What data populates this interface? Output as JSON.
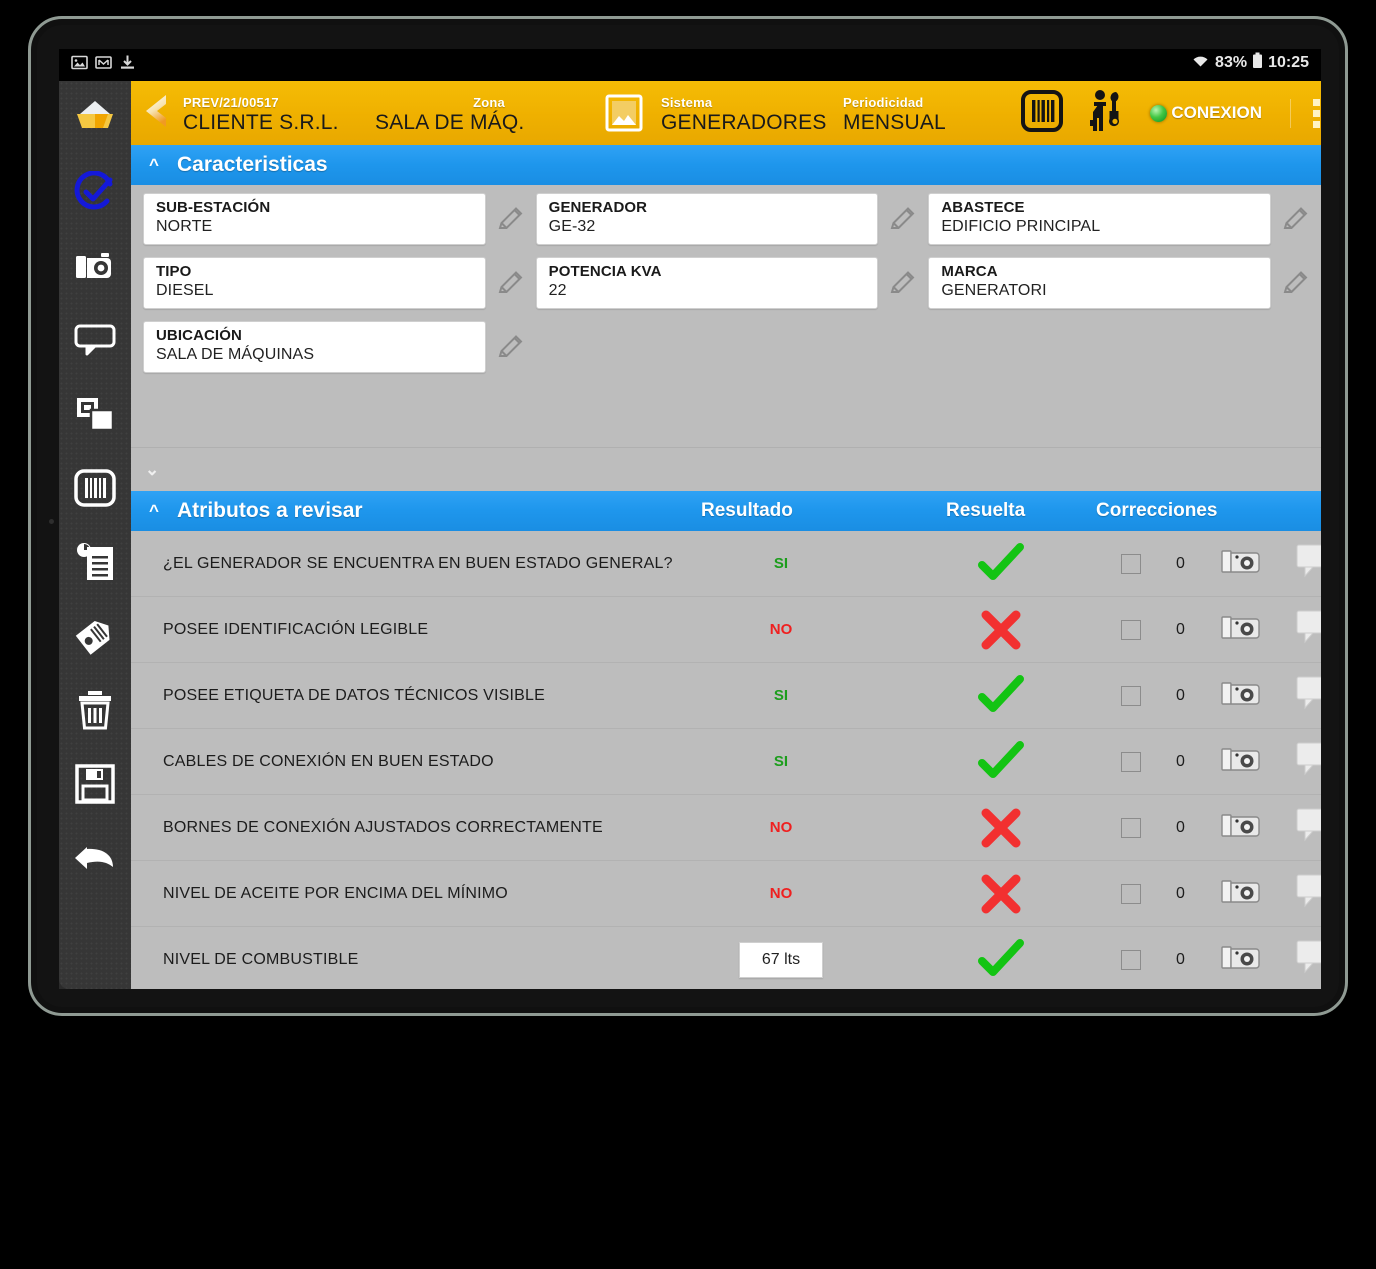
{
  "status_bar": {
    "left_icons": [
      "image-icon",
      "mail-icon",
      "download-icon"
    ],
    "wifi_icon": "wifi-icon",
    "battery_percent": "83%",
    "battery_icon": "battery-icon",
    "time": "10:25"
  },
  "sidebar": {
    "items": [
      {
        "icon": "folder-open-icon",
        "name": "sidebar-item-folder"
      },
      {
        "icon": "check-circle-icon",
        "name": "sidebar-item-check"
      },
      {
        "icon": "camera-icon",
        "name": "sidebar-item-camera"
      },
      {
        "icon": "comment-icon",
        "name": "sidebar-item-comment"
      },
      {
        "icon": "copy-icon",
        "name": "sidebar-item-copy"
      },
      {
        "icon": "barcode-icon",
        "name": "sidebar-item-barcode"
      },
      {
        "icon": "clipboard-icon",
        "name": "sidebar-item-clipboard"
      },
      {
        "icon": "tag-icon",
        "name": "sidebar-item-tag"
      },
      {
        "icon": "trash-icon",
        "name": "sidebar-item-trash"
      },
      {
        "icon": "save-icon",
        "name": "sidebar-item-save"
      },
      {
        "icon": "back-arrow-icon",
        "name": "sidebar-item-back"
      }
    ]
  },
  "topbar": {
    "back_icon": "back-chevron-icon",
    "order_number": "PREV/21/00517",
    "client": "CLIENTE S.R.L.",
    "zona_label": "Zona",
    "zona_value": "SALA DE MÁQ.",
    "system_icon": "photo-icon",
    "sistema_label": "Sistema",
    "sistema_value": "GENERADORES",
    "periodicidad_label": "Periodicidad",
    "periodicidad_value": "MENSUAL",
    "barcode_icon": "barcode-icon",
    "technician_icon": "technician-icon",
    "connection_label": "CONEXION",
    "connection_led_color": "#2ebf2e",
    "overflow_icon": "kebab-menu-icon",
    "background_color": "#efb000"
  },
  "caracteristicas": {
    "title": "Caracteristicas",
    "collapse_icon": "chevron-up-icon",
    "expand_icon": "chevron-down-icon",
    "edit_icon": "pencil-icon",
    "fields": [
      {
        "label": "SUB-ESTACIÓN",
        "value": "NORTE"
      },
      {
        "label": "GENERADOR",
        "value": "GE-32"
      },
      {
        "label": "ABASTECE",
        "value": "EDIFICIO PRINCIPAL"
      },
      {
        "label": "TIPO",
        "value": "DIESEL"
      },
      {
        "label": "POTENCIA KVA",
        "value": "22"
      },
      {
        "label": "MARCA",
        "value": "GENERATORI"
      },
      {
        "label": "UBICACIÓN",
        "value": "SALA DE MÁQUINAS"
      }
    ]
  },
  "atributos": {
    "title": "Atributos a revisar",
    "collapse_icon": "chevron-up-icon",
    "columns": {
      "resultado": "Resultado",
      "resuelta": "Resuelta",
      "correcciones": "Correcciones"
    },
    "header_color": "#1e96ec",
    "rows": [
      {
        "name": "¿EL GENERADOR SE ENCUENTRA EN BUEN ESTADO GENERAL?",
        "resultado": "SI",
        "result_type": "si",
        "resuelta": "check-icon",
        "corrections": "0",
        "camera_icon": "camera-icon",
        "comment_icon": "comment-icon"
      },
      {
        "name": "POSEE IDENTIFICACIÓN LEGIBLE",
        "resultado": "NO",
        "result_type": "no",
        "resuelta": "cross-icon",
        "corrections": "0",
        "camera_icon": "camera-icon",
        "comment_icon": "comment-icon"
      },
      {
        "name": "POSEE ETIQUETA DE DATOS TÉCNICOS VISIBLE",
        "resultado": "SI",
        "result_type": "si",
        "resuelta": "check-icon",
        "corrections": "0",
        "camera_icon": "camera-icon",
        "comment_icon": "comment-icon"
      },
      {
        "name": "CABLES DE CONEXIÓN EN BUEN ESTADO",
        "resultado": "SI",
        "result_type": "si",
        "resuelta": "check-icon",
        "corrections": "0",
        "camera_icon": "camera-icon",
        "comment_icon": "comment-icon"
      },
      {
        "name": "BORNES DE CONEXIÓN AJUSTADOS CORRECTAMENTE",
        "resultado": "NO",
        "result_type": "no",
        "resuelta": "cross-icon",
        "corrections": "0",
        "camera_icon": "camera-icon",
        "comment_icon": "comment-icon"
      },
      {
        "name": "NIVEL DE ACEITE POR ENCIMA DEL MÍNIMO",
        "resultado": "NO",
        "result_type": "no",
        "resuelta": "cross-icon",
        "corrections": "0",
        "camera_icon": "camera-icon",
        "comment_icon": "comment-icon"
      },
      {
        "name": "NIVEL DE COMBUSTIBLE",
        "resultado": "67 lts",
        "result_type": "chip",
        "resuelta": "check-icon",
        "corrections": "0",
        "camera_icon": "camera-icon",
        "comment_icon": "comment-icon"
      }
    ]
  },
  "colors": {
    "accent_yellow": "#efb000",
    "accent_blue": "#1e96ec",
    "ok_green": "#1c9d1c",
    "fail_red": "#ef2020",
    "panel_gray": "#bdbdbd",
    "rail_dark": "#363636"
  }
}
